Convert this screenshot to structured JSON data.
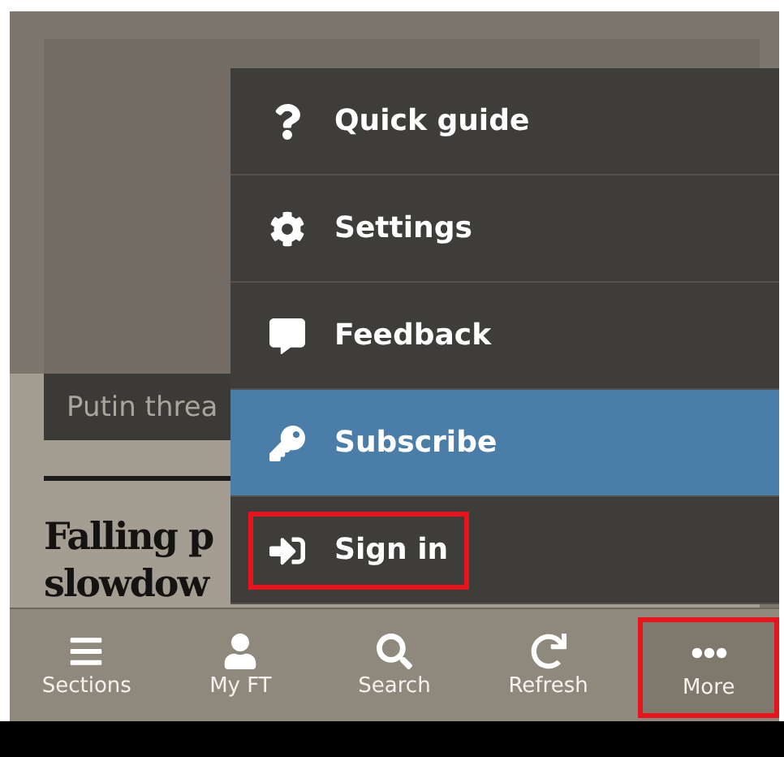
{
  "article": {
    "teaser": "Putin threa",
    "headline_lines": [
      "Falling p",
      "slowdow"
    ]
  },
  "menu": {
    "items": [
      {
        "label": "Quick guide",
        "kind": "question",
        "selected": false,
        "highlighted": false
      },
      {
        "label": "Settings",
        "kind": "gear",
        "selected": false,
        "highlighted": false
      },
      {
        "label": "Feedback",
        "kind": "speech",
        "selected": false,
        "highlighted": false
      },
      {
        "label": "Subscribe",
        "kind": "key",
        "selected": true,
        "highlighted": false
      },
      {
        "label": "Sign in",
        "kind": "signin",
        "selected": false,
        "highlighted": true
      }
    ]
  },
  "tab_bar": {
    "tabs": [
      {
        "label": "Sections",
        "kind": "bars",
        "highlighted": false
      },
      {
        "label": "My FT",
        "kind": "user",
        "highlighted": false
      },
      {
        "label": "Search",
        "kind": "search",
        "highlighted": false
      },
      {
        "label": "Refresh",
        "kind": "refresh",
        "highlighted": false
      },
      {
        "label": "More",
        "kind": "dots",
        "highlighted": true
      }
    ]
  }
}
